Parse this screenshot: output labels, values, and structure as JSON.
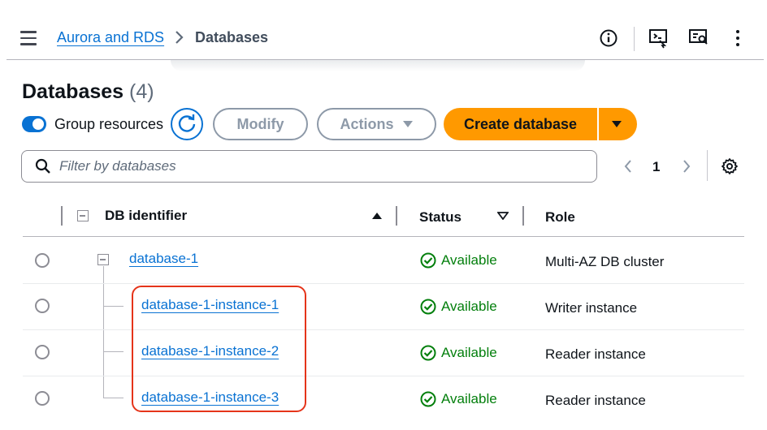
{
  "breadcrumb": {
    "parent": "Aurora and RDS",
    "current": "Databases"
  },
  "header": {
    "title": "Databases",
    "count": "(4)"
  },
  "toolbar": {
    "group_resources_label": "Group resources",
    "group_resources_on": true,
    "modify_label": "Modify",
    "actions_label": "Actions",
    "create_label": "Create database"
  },
  "filter": {
    "placeholder": "Filter by databases"
  },
  "pagination": {
    "current_page": "1"
  },
  "table": {
    "columns": {
      "identifier": "DB identifier",
      "status": "Status",
      "role": "Role"
    },
    "rows": [
      {
        "identifier": "database-1",
        "status": "Available",
        "role": "Multi-AZ DB cluster"
      },
      {
        "identifier": "database-1-instance-1",
        "status": "Available",
        "role": "Writer instance"
      },
      {
        "identifier": "database-1-instance-2",
        "status": "Available",
        "role": "Reader instance"
      },
      {
        "identifier": "database-1-instance-3",
        "status": "Available",
        "role": "Reader instance"
      }
    ]
  },
  "colors": {
    "accent": "#0972d3",
    "primary_button": "#ff9900",
    "success": "#037f0c",
    "highlight": "#e5341a"
  },
  "icons": [
    "menu-icon",
    "chevron-right-icon",
    "info-icon",
    "console-icon",
    "screen-icon",
    "more-vertical-icon",
    "refresh-icon",
    "caret-down-icon",
    "search-icon",
    "chevron-left-icon",
    "settings-icon",
    "sort-up-icon",
    "sort-down-icon",
    "collapse-icon",
    "check-circle-icon"
  ]
}
